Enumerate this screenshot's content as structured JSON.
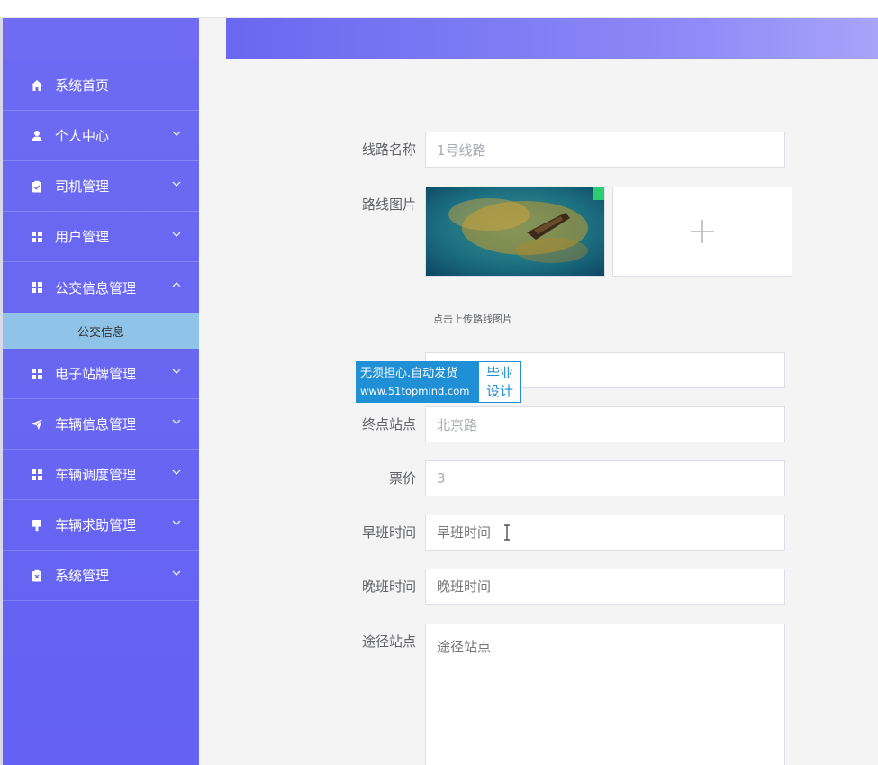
{
  "topbar": {
    "fragment": ""
  },
  "colors": {
    "sidebar": "#6d6bf2",
    "active_submenu": "#8fc4e8",
    "banner_start": "#6a67f0",
    "banner_end": "#a8a4f9",
    "watermark_blue": "#1f8fd6"
  },
  "sidebar": {
    "items": [
      {
        "label": "系统首页",
        "icon": "home-icon",
        "expandable": false
      },
      {
        "label": "个人中心",
        "icon": "user-icon",
        "expandable": true
      },
      {
        "label": "司机管理",
        "icon": "clipboard-check-icon",
        "expandable": true
      },
      {
        "label": "用户管理",
        "icon": "grid-icon",
        "expandable": true
      },
      {
        "label": "公交信息管理",
        "icon": "grid-icon",
        "expandable": true,
        "expanded": true
      },
      {
        "label": "电子站牌管理",
        "icon": "grid-icon",
        "expandable": true
      },
      {
        "label": "车辆信息管理",
        "icon": "send-icon",
        "expandable": true
      },
      {
        "label": "车辆调度管理",
        "icon": "grid-icon",
        "expandable": true
      },
      {
        "label": "车辆求助管理",
        "icon": "brush-icon",
        "expandable": true
      },
      {
        "label": "系统管理",
        "icon": "clipboard-x-icon",
        "expandable": true
      }
    ],
    "submenu": {
      "label": "公交信息"
    }
  },
  "form": {
    "route_name": {
      "label": "线路名称",
      "value": "1号线路"
    },
    "route_image": {
      "label": "路线图片",
      "tip": "点击上传路线图片"
    },
    "start_station": {
      "label": "",
      "value": ""
    },
    "end_station": {
      "label": "终点站点",
      "value": "北京路"
    },
    "price": {
      "label": "票价",
      "value": "3"
    },
    "morning_time": {
      "label": "早班时间",
      "placeholder": "早班时间"
    },
    "evening_time": {
      "label": "晚班时间",
      "placeholder": "晚班时间"
    },
    "via_stations": {
      "label": "途径站点",
      "placeholder": "途径站点"
    }
  },
  "watermark": {
    "line1": "无须担心.自动发货",
    "line2": "www.51topmind.com",
    "right_line1": "毕业",
    "right_line2": "设计"
  }
}
